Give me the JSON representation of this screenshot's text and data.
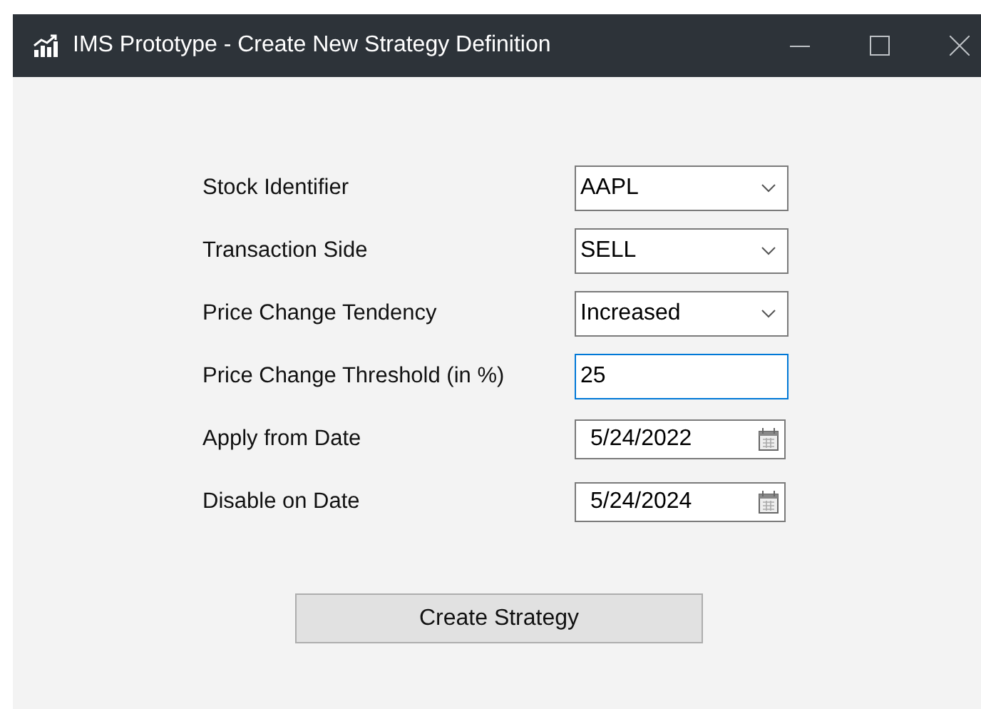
{
  "window": {
    "title": "IMS Prototype - Create New Strategy Definition"
  },
  "fields": [
    {
      "label": "Stock Identifier",
      "kind": "dropdown",
      "value": "AAPL",
      "focused": false
    },
    {
      "label": "Transaction Side",
      "kind": "dropdown",
      "value": "SELL",
      "focused": false
    },
    {
      "label": "Price Change Tendency",
      "kind": "dropdown",
      "value": "Increased",
      "focused": false
    },
    {
      "label": "Price Change Threshold (in %)",
      "kind": "text",
      "value": "25",
      "focused": true
    },
    {
      "label": "Apply from Date",
      "kind": "date",
      "value": "5/24/2022",
      "focused": false
    },
    {
      "label": "Disable on Date",
      "kind": "date",
      "value": "5/24/2024",
      "focused": false
    }
  ],
  "button": {
    "label": "Create Strategy"
  }
}
